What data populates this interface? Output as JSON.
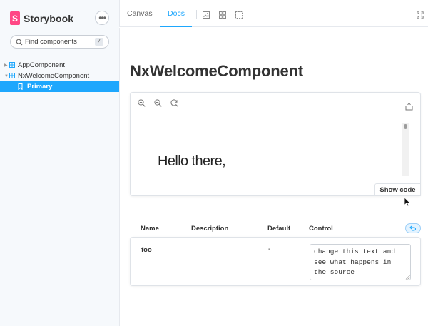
{
  "app": {
    "name": "Storybook",
    "logo_letter": "S",
    "accent": "#1ea7fd",
    "brand_color": "#ff4785"
  },
  "sidebar": {
    "menu_icon": "ellipsis-icon",
    "search": {
      "placeholder": "Find components",
      "shortcut": "/"
    },
    "tree": [
      {
        "label": "AppComponent",
        "type": "component",
        "expanded": false
      },
      {
        "label": "NxWelcomeComponent",
        "type": "component",
        "expanded": true
      },
      {
        "label": "Primary",
        "type": "story",
        "selected": true
      }
    ]
  },
  "toolbar": {
    "tabs": [
      {
        "label": "Canvas",
        "active": false
      },
      {
        "label": "Docs",
        "active": true
      }
    ],
    "icons": [
      "image-icon",
      "grid-icon",
      "outline-icon",
      "fullscreen-icon"
    ]
  },
  "doc": {
    "title": "NxWelcomeComponent",
    "preview": {
      "tools": [
        "zoom-in-icon",
        "zoom-out-icon",
        "zoom-reset-icon",
        "share-icon"
      ],
      "content_text": "Hello there,",
      "show_code_label": "Show code"
    },
    "args_table": {
      "headers": {
        "name": "Name",
        "description": "Description",
        "default": "Default",
        "control": "Control"
      },
      "rows": [
        {
          "name": "foo",
          "description": "",
          "default": "-",
          "control_value": "change this text and see what happens in the source"
        }
      ]
    }
  }
}
